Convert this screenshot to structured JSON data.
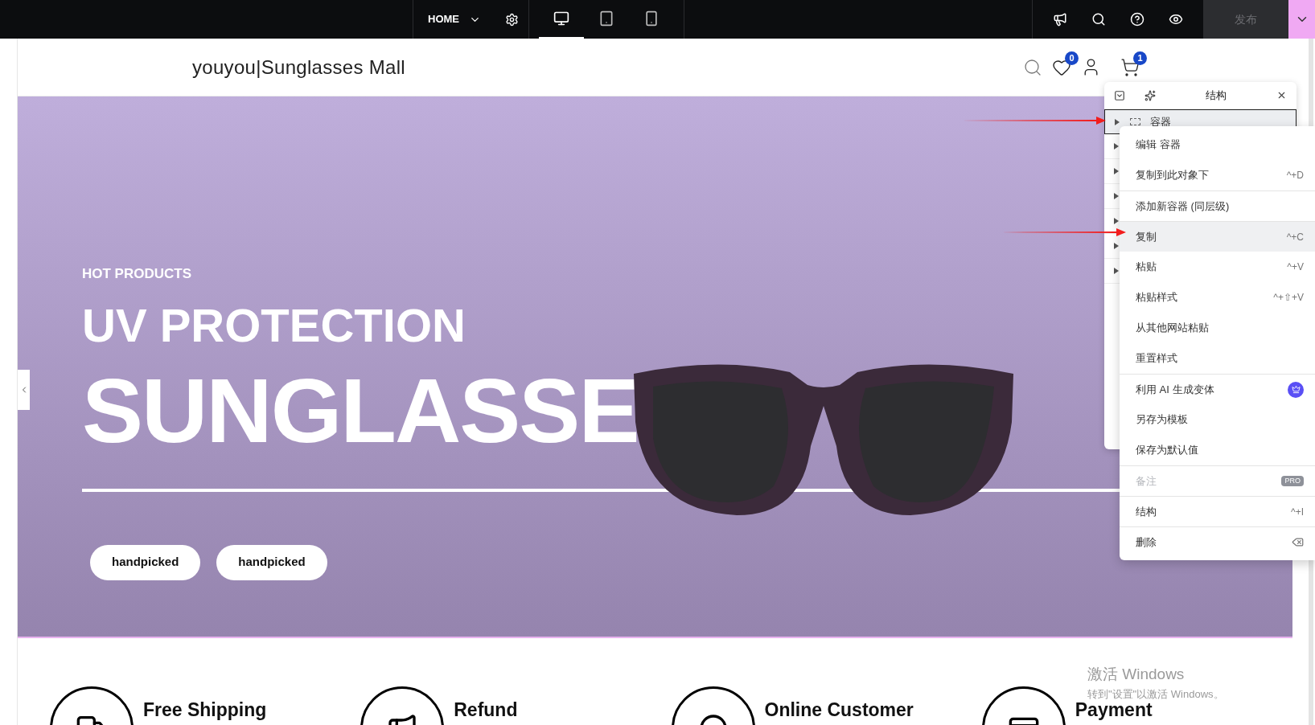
{
  "toolbar": {
    "page_menu": "HOME",
    "devices": [
      {
        "kind": "desktop",
        "selected": true
      },
      {
        "kind": "tablet",
        "selected": false
      },
      {
        "kind": "mobile",
        "selected": false
      }
    ],
    "publish": {
      "label": "发布",
      "disabled": true
    }
  },
  "header": {
    "logo": "youyou|Sunglasses Mall",
    "wishlist_count": "0",
    "cart_count": "1"
  },
  "hero": {
    "eyebrow": "HOT PRODUCTS",
    "title": "UV PROTECTION",
    "headline": "SUNGLASSE",
    "buttons": [
      "handpicked",
      "handpicked"
    ]
  },
  "features": [
    "Free Shipping",
    "Refund",
    "Online Customer",
    "Payment"
  ],
  "structure_panel": {
    "title": "结构",
    "rows": [
      {
        "label": "容器",
        "selected": true,
        "expanded": false
      },
      {
        "selected": false,
        "expanded": false
      },
      {
        "selected": false,
        "expanded": false
      },
      {
        "selected": false,
        "expanded": false
      },
      {
        "selected": false,
        "expanded": false
      },
      {
        "selected": false,
        "expanded": false
      },
      {
        "selected": false,
        "expanded": false
      }
    ]
  },
  "context_menu": [
    {
      "label": "编辑 容器",
      "kind": "plain",
      "selected": false,
      "disabled": false,
      "divider_before": false
    },
    {
      "label": "复制到此对象下",
      "kind": "shortcut",
      "shortcut": "^+D",
      "selected": false,
      "disabled": false,
      "divider_before": false
    },
    {
      "label": "添加新容器 (同层级)",
      "kind": "plain",
      "selected": false,
      "disabled": false,
      "divider_before": true
    },
    {
      "label": "复制",
      "kind": "shortcut",
      "shortcut": "^+C",
      "selected": true,
      "disabled": false,
      "divider_before": true
    },
    {
      "label": "粘贴",
      "kind": "shortcut",
      "shortcut": "^+V",
      "selected": false,
      "disabled": false,
      "divider_before": false
    },
    {
      "label": "粘贴样式",
      "kind": "shortcut",
      "shortcut": "^+⇧+V",
      "selected": false,
      "disabled": false,
      "divider_before": false
    },
    {
      "label": "从其他网站粘贴",
      "kind": "plain",
      "selected": false,
      "disabled": false,
      "divider_before": false
    },
    {
      "label": "重置样式",
      "kind": "plain",
      "selected": false,
      "disabled": false,
      "divider_before": false
    },
    {
      "label": "利用 AI 生成变体",
      "kind": "premium",
      "selected": false,
      "disabled": false,
      "divider_before": true
    },
    {
      "label": "另存为模板",
      "kind": "plain",
      "selected": false,
      "disabled": false,
      "divider_before": false
    },
    {
      "label": "保存为默认值",
      "kind": "plain",
      "selected": false,
      "disabled": false,
      "divider_before": false
    },
    {
      "label": "备注",
      "kind": "pro",
      "badge": "PRO",
      "selected": false,
      "disabled": true,
      "divider_before": true
    },
    {
      "label": "结构",
      "kind": "shortcut",
      "shortcut": "^+I",
      "selected": false,
      "disabled": false,
      "divider_before": true
    },
    {
      "label": "删除",
      "kind": "delete",
      "selected": false,
      "disabled": false,
      "divider_before": true
    }
  ],
  "activation_notice": {
    "title": "激活 Windows",
    "text": "转到\"设置\"以激活 Windows。"
  }
}
